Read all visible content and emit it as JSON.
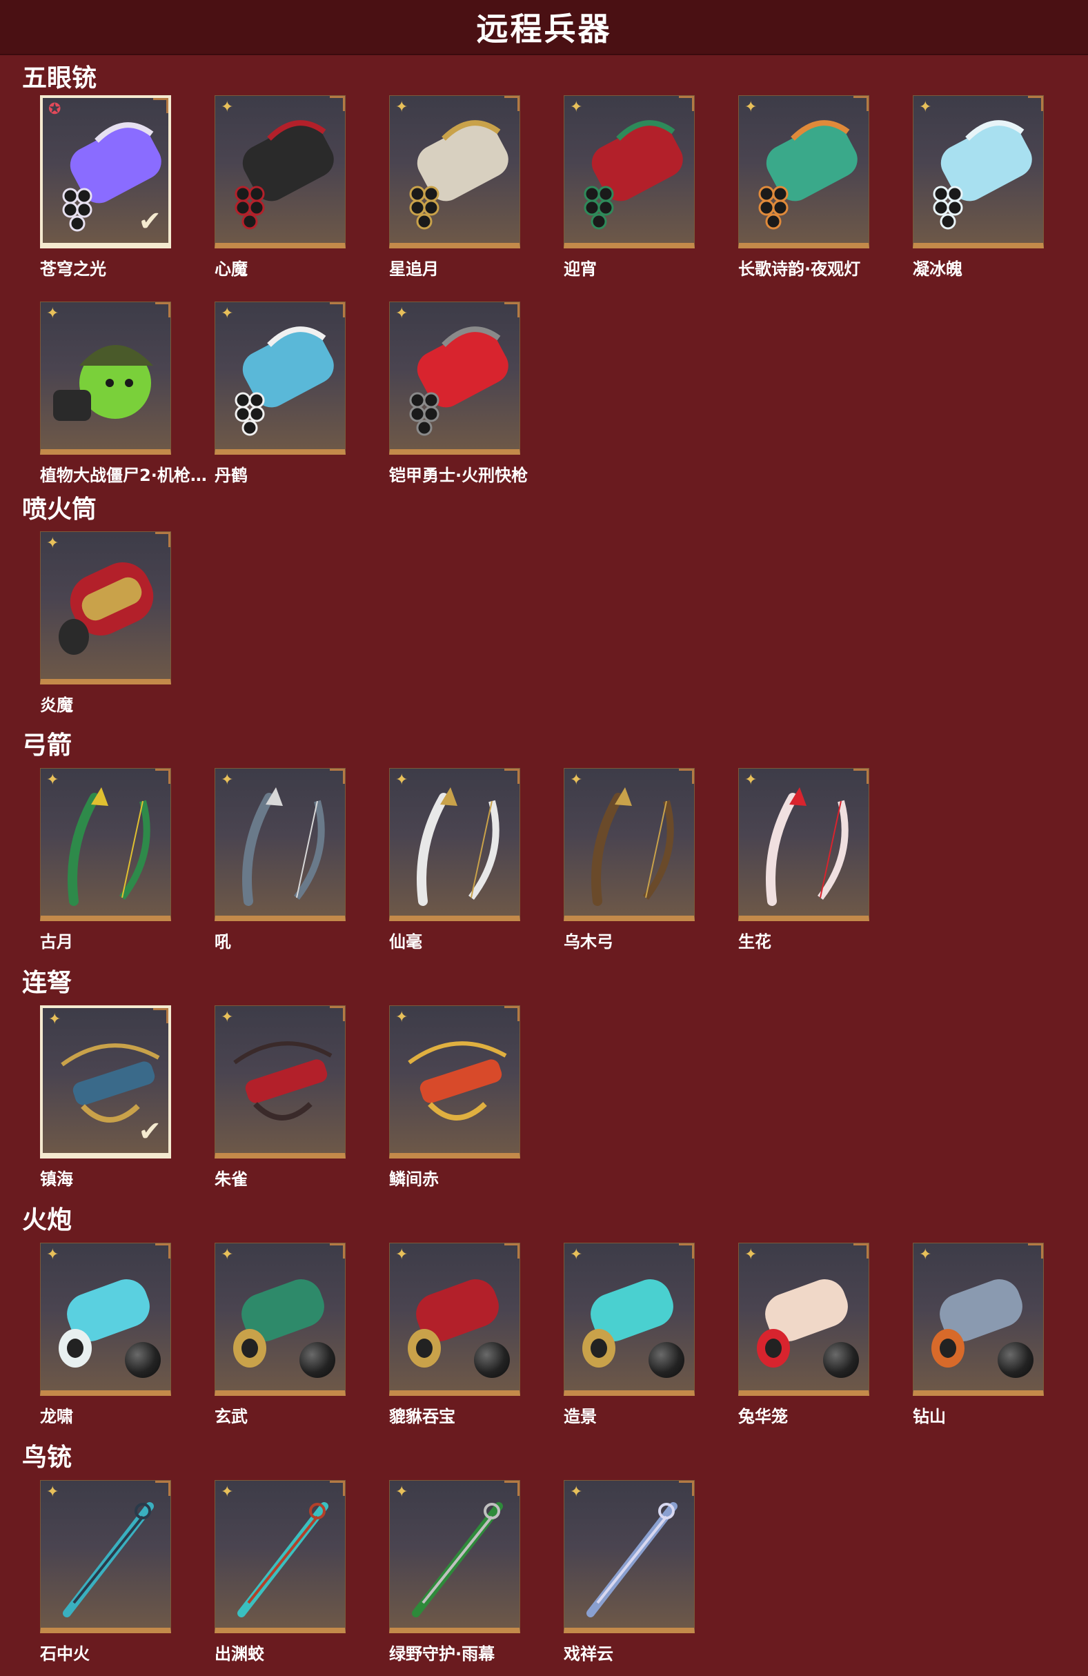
{
  "title": "远程兵器",
  "sections": [
    {
      "name": "五眼铳",
      "items": [
        {
          "label": "苍穹之光",
          "icon": "five-barrel-gun-icon",
          "rarity": "star",
          "selected": true,
          "c1": "#8a6cff",
          "c2": "#e6e0f0"
        },
        {
          "label": "心魔",
          "icon": "five-barrel-gun-icon",
          "rarity": "shuriken",
          "c1": "#2a2a2a",
          "c2": "#b3202a"
        },
        {
          "label": "星追月",
          "icon": "five-barrel-gun-icon",
          "rarity": "shuriken",
          "c1": "#d8d0c0",
          "c2": "#c9a24a"
        },
        {
          "label": "迎宵",
          "icon": "five-barrel-gun-icon",
          "rarity": "shuriken",
          "c1": "#b3202a",
          "c2": "#2e8a5a"
        },
        {
          "label": "长歌诗韵·夜观灯",
          "icon": "five-barrel-gun-icon",
          "rarity": "shuriken",
          "c1": "#3aa98a",
          "c2": "#e08a3a"
        },
        {
          "label": "凝冰魄",
          "icon": "five-barrel-gun-icon",
          "rarity": "shuriken",
          "c1": "#a8e0f0",
          "c2": "#e8f4f8"
        },
        {
          "label": "植物大战僵尸2·机枪…",
          "icon": "peashooter-gun-icon",
          "rarity": "shuriken",
          "c1": "#7ad03a",
          "c2": "#4a5a2a"
        },
        {
          "label": "丹鹤",
          "icon": "five-barrel-gun-icon",
          "rarity": "shuriken",
          "c1": "#5ab8d8",
          "c2": "#f0f0f0"
        },
        {
          "label": "铠甲勇士·火刑快枪",
          "icon": "five-barrel-gun-icon",
          "rarity": "shuriken",
          "c1": "#d8242e",
          "c2": "#8a8a8a"
        }
      ]
    },
    {
      "name": "喷火筒",
      "items": [
        {
          "label": "炎魔",
          "icon": "flamethrower-icon",
          "rarity": "shuriken",
          "c1": "#b3202a",
          "c2": "#c9a24a"
        }
      ]
    },
    {
      "name": "弓箭",
      "items": [
        {
          "label": "古月",
          "icon": "bow-icon",
          "rarity": "shuriken",
          "c1": "#2e8a4a",
          "c2": "#e0c030"
        },
        {
          "label": "吼",
          "icon": "bow-icon",
          "rarity": "shuriken",
          "c1": "#6a7a8a",
          "c2": "#d8d8d8"
        },
        {
          "label": "仙毫",
          "icon": "bow-icon",
          "rarity": "shuriken",
          "c1": "#e8e8e8",
          "c2": "#c9a24a"
        },
        {
          "label": "乌木弓",
          "icon": "bow-icon",
          "rarity": "shuriken",
          "c1": "#6a4a2a",
          "c2": "#c9a24a"
        },
        {
          "label": "生花",
          "icon": "bow-icon",
          "rarity": "shuriken",
          "c1": "#f0e0e0",
          "c2": "#d8242e"
        }
      ]
    },
    {
      "name": "连弩",
      "items": [
        {
          "label": "镇海",
          "icon": "crossbow-icon",
          "rarity": "shuriken",
          "selected": true,
          "c1": "#3a6a8a",
          "c2": "#c9a24a"
        },
        {
          "label": "朱雀",
          "icon": "crossbow-icon",
          "rarity": "shuriken",
          "c1": "#b3202a",
          "c2": "#3a2a2a"
        },
        {
          "label": "鳞间赤",
          "icon": "crossbow-icon",
          "rarity": "shuriken",
          "c1": "#d84a2a",
          "c2": "#e0b040"
        }
      ]
    },
    {
      "name": "火炮",
      "items": [
        {
          "label": "龙啸",
          "icon": "cannon-icon",
          "rarity": "shuriken",
          "c1": "#5ad0e0",
          "c2": "#e8f0f0"
        },
        {
          "label": "玄武",
          "icon": "cannon-icon",
          "rarity": "shuriken",
          "c1": "#2e8a6a",
          "c2": "#c9a24a"
        },
        {
          "label": "貔貅吞宝",
          "icon": "cannon-icon",
          "rarity": "shuriken",
          "c1": "#b3202a",
          "c2": "#c9a24a"
        },
        {
          "label": "造景",
          "icon": "cannon-icon",
          "rarity": "shuriken",
          "c1": "#4ad0d0",
          "c2": "#c9a24a"
        },
        {
          "label": "兔华笼",
          "icon": "cannon-icon",
          "rarity": "shuriken",
          "c1": "#f0d8c8",
          "c2": "#d8242e"
        },
        {
          "label": "钻山",
          "icon": "cannon-icon",
          "rarity": "shuriken",
          "c1": "#8a9ab0",
          "c2": "#d86a2a"
        }
      ]
    },
    {
      "name": "鸟铳",
      "items": [
        {
          "label": "石中火",
          "icon": "musket-icon",
          "rarity": "shuriken",
          "c1": "#3ab0c0",
          "c2": "#2a3a4a"
        },
        {
          "label": "出渊蛟",
          "icon": "musket-icon",
          "rarity": "shuriken",
          "c1": "#3ac0c0",
          "c2": "#b3402a"
        },
        {
          "label": "绿野守护·雨幕",
          "icon": "musket-icon",
          "rarity": "shuriken",
          "c1": "#2e8a3a",
          "c2": "#c0c0c0"
        },
        {
          "label": "戏祥云",
          "icon": "musket-icon",
          "rarity": "shuriken",
          "c1": "#8aa0d0",
          "c2": "#d8d8f0"
        }
      ]
    }
  ]
}
